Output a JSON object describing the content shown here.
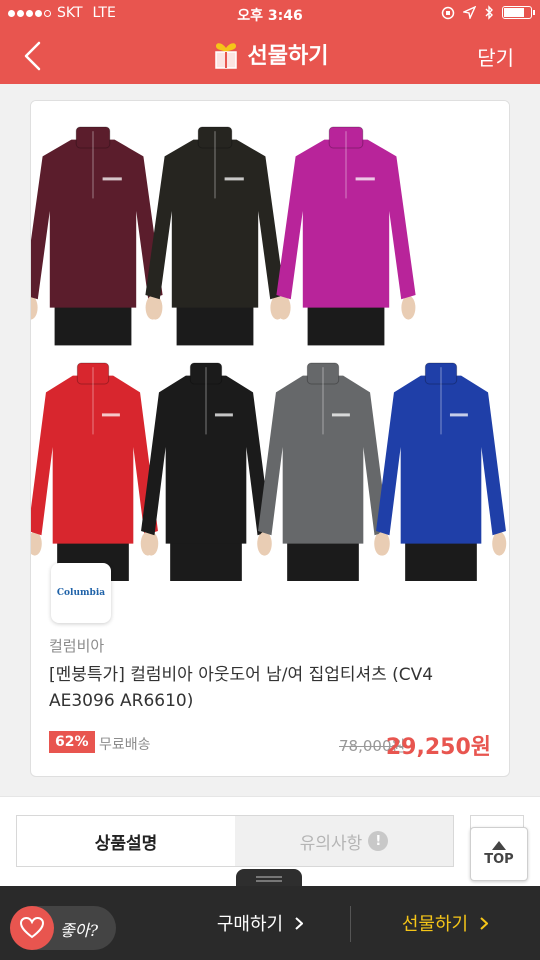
{
  "status_bar": {
    "carrier": "SKT",
    "network": "LTE",
    "time": "오후 3:46",
    "signal_bars": 4,
    "battery_level": 0.85
  },
  "header": {
    "title": "선물하기",
    "close_label": "닫기",
    "back_icon": "chevron-left-icon",
    "gift_icon": "gift-icon"
  },
  "product": {
    "brand_logo_text": "Columbia",
    "brand_name": "컬럼비아",
    "title": "[멘붕특가] 컬럼비아 아웃도어 남/여 집업티셔츠 (CV4 AE3096 AR6610)",
    "discount": "62%",
    "shipping": "무료배송",
    "original_price": "78,000원",
    "sale_price": "29,250원",
    "image_colors": {
      "row1": [
        "#5b1d2c",
        "#262520",
        "#b8249a"
      ],
      "row2": [
        "#d8262e",
        "#1b1b1b",
        "#66686a",
        "#1f3fa8"
      ]
    }
  },
  "tabs": {
    "description": "상품설명",
    "notice": "유의사항"
  },
  "top_button": {
    "label": "TOP"
  },
  "bottom_bar": {
    "like_label": "좋아?",
    "buy_label": "구매하기",
    "gift_label": "선물하기"
  },
  "colors": {
    "accent": "#e8554f",
    "gift_yellow": "#f5c518",
    "bar_dark": "#2a2a2a"
  }
}
